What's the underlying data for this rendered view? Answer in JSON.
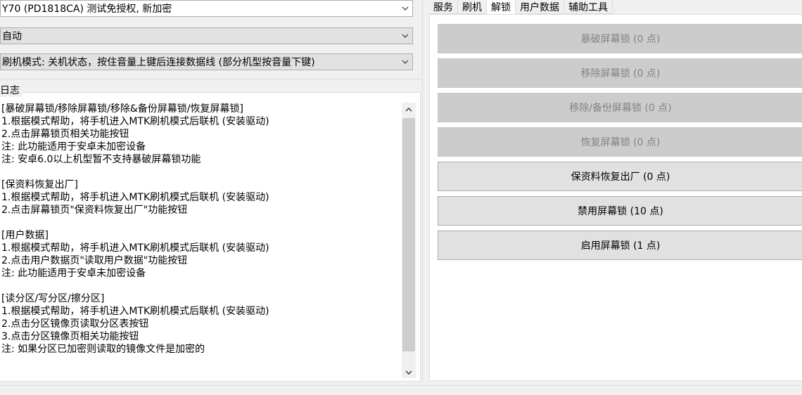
{
  "device_select": {
    "value": "Y70 (PD1818CA) 测试免授权, 新加密"
  },
  "mode_select": {
    "value": "自动"
  },
  "flash_mode_select": {
    "value": "刷机模式: 关机状态，按住音量上键后连接数据线 (部分机型按音量下键)"
  },
  "log": {
    "label": "日志",
    "lines": [
      "[暴破屏幕锁/移除屏幕锁/移除&备份屏幕锁/恢复屏幕锁]",
      "1.根据模式帮助，将手机进入MTK刷机模式后联机 (安装驱动)",
      "2.点击屏幕锁页相关功能按钮",
      "注: 此功能适用于安卓未加密设备",
      "注: 安卓6.0以上机型暂不支持暴破屏幕锁功能",
      "",
      "[保资料恢复出厂]",
      "1.根据模式帮助，将手机进入MTK刷机模式后联机 (安装驱动)",
      "2.点击屏幕锁页\"保资料恢复出厂\"功能按钮",
      "",
      "[用户数据]",
      "1.根据模式帮助，将手机进入MTK刷机模式后联机 (安装驱动)",
      "2.点击用户数据页\"读取用户数据\"功能按钮",
      "注: 此功能适用于安卓未加密设备",
      "",
      "[读分区/写分区/擦分区]",
      "1.根据模式帮助，将手机进入MTK刷机模式后联机 (安装驱动)",
      "2.点击分区镜像页读取分区表按钮",
      "3.点击分区镜像页相关功能按钮",
      "注: 如果分区已加密则读取的镜像文件是加密的"
    ]
  },
  "tabs": [
    {
      "label": "服务",
      "active": false
    },
    {
      "label": "刷机",
      "active": false
    },
    {
      "label": "解锁",
      "active": true
    },
    {
      "label": "用户数据",
      "active": false
    },
    {
      "label": "辅助工具",
      "active": false
    }
  ],
  "buttons": [
    {
      "label": "暴破屏幕锁 (0 点)",
      "enabled": false
    },
    {
      "label": "移除屏幕锁 (0 点)",
      "enabled": false
    },
    {
      "label": "移除/备份屏幕锁 (0 点)",
      "enabled": false
    },
    {
      "label": "恢复屏幕锁 (0 点)",
      "enabled": false
    },
    {
      "label": "保资料恢复出厂 (0 点)",
      "enabled": true
    },
    {
      "label": "禁用屏幕锁 (10 点)",
      "enabled": true
    },
    {
      "label": "启用屏幕锁 (1 点)",
      "enabled": true
    }
  ]
}
